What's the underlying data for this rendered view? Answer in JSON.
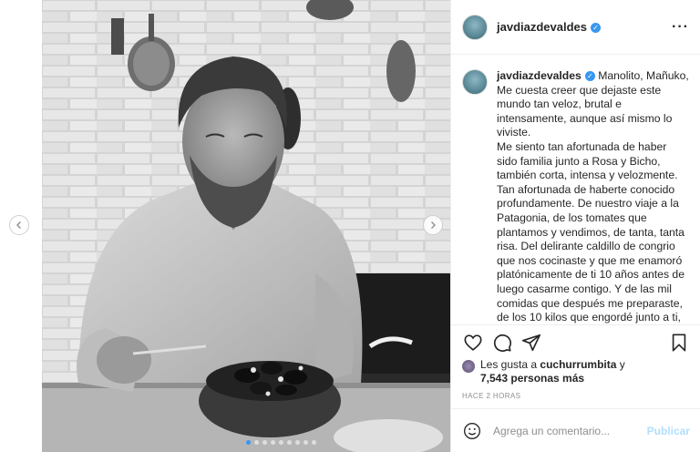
{
  "post": {
    "username": "javdiazdevaldes",
    "verified": true,
    "caption_lines": [
      "Manolito, Mañuko,",
      "Me cuesta creer que dejaste este mundo tan veloz, brutal e intensamente, aunque así mismo lo viviste.",
      "Me siento tan afortunada de haber sido familia junto a Rosa y Bicho, también corta, intensa y velozmente.",
      "Tan afortunada de haberte conocido profundamente. De nuestro viaje a la Patagonia, de los tomates que plantamos y vendimos, de tanta, tanta risa. Del delirante caldillo de congrio que nos cocinaste y que me enamoró platónicamente de ti 10 años antes de luego casarme contigo. Y de las mil comidas que después me preparaste, de los 10 kilos que engordé junto a ti, del whiskey ahumado en el termo"
    ],
    "likes_prefix": "Les gusta a",
    "liked_by": "cuchurrumbita",
    "likes_joiner": "y",
    "likes_count": "7,543 personas más",
    "time_ago": "HACE 2 HORAS"
  },
  "comment": {
    "placeholder": "Agrega un comentario...",
    "publish_label": "Publicar"
  },
  "carousel": {
    "total_slides": 9,
    "active_slide": 1
  },
  "icons": {
    "prev": "chevron-left-icon",
    "next": "chevron-right-icon",
    "like": "heart-icon",
    "comment": "comment-icon",
    "share": "paper-plane-icon",
    "save": "bookmark-icon",
    "more": "more-icon",
    "emoji": "emoji-icon",
    "verified": "verified-badge-icon"
  },
  "colors": {
    "accent": "#3897f0",
    "publish_disabled": "#b2dffc",
    "muted": "#8e8e8e"
  }
}
